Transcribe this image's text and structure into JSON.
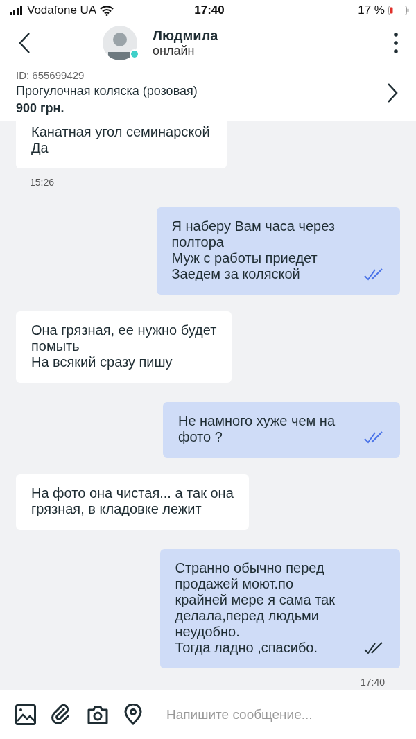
{
  "status_bar": {
    "carrier": "Vodafone UA",
    "time": "17:40",
    "battery": "17 %"
  },
  "header": {
    "name": "Людмила",
    "status": "онлайн",
    "online": true
  },
  "listing": {
    "id": "ID: 655699429",
    "title": "Прогулочная коляска (розовая)",
    "price": "900 грн."
  },
  "messages": [
    {
      "kind": "incoming",
      "text": "Канатная угол семинарской\nДа",
      "time": "15:26"
    },
    {
      "kind": "outgoing",
      "text": "Я наберу Вам часа через\nполтора\nМуж с работы приедет\nЗаедем за коляской",
      "read": true
    },
    {
      "kind": "incoming",
      "text": "Она грязная, ее нужно будет\nпомыть\nНа всякий сразу пишу"
    },
    {
      "kind": "outgoing",
      "text": "Не намного хуже чем на\nфото ?",
      "read": true
    },
    {
      "kind": "incoming",
      "text": "На фото она чистая... а так она\nгрязная, в кладовке лежит"
    },
    {
      "kind": "outgoing",
      "text": "Странно обычно перед\nпродажей моют.по\nкрайней мере я сама так\nделала,перед людьми\nнеудобно.\nТогда ладно ,спасибо.",
      "read": false,
      "time": "17:40"
    }
  ],
  "composer": {
    "placeholder": "Напишите сообщение..."
  }
}
